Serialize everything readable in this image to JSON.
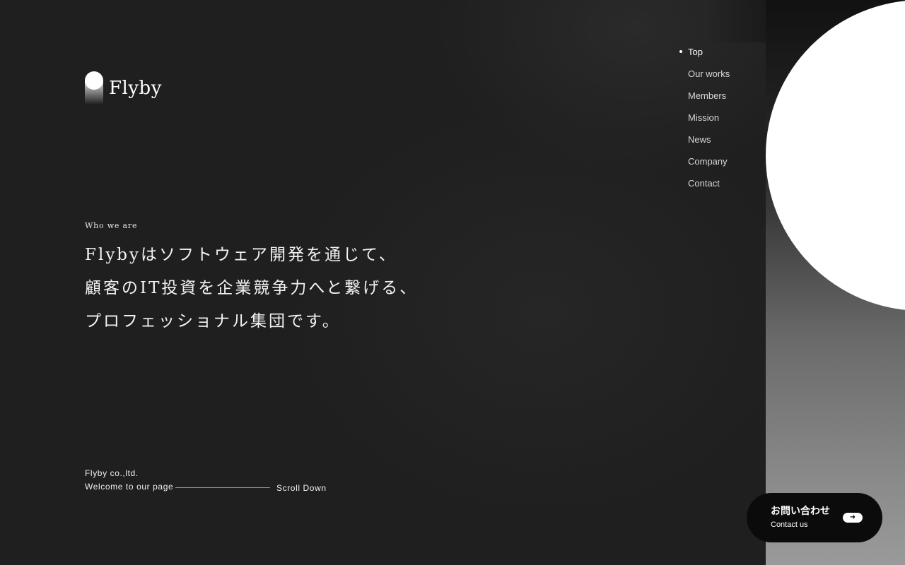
{
  "brand": {
    "name": "Flyby"
  },
  "nav": {
    "items": [
      {
        "label": "Top",
        "active": true
      },
      {
        "label": "Our works",
        "active": false
      },
      {
        "label": "Members",
        "active": false
      },
      {
        "label": "Mission",
        "active": false
      },
      {
        "label": "News",
        "active": false
      },
      {
        "label": "Company",
        "active": false
      },
      {
        "label": "Contact",
        "active": false
      }
    ]
  },
  "hero": {
    "eyebrow": "Who we are",
    "lines": [
      "Flybyはソフトウェア開発を通じて、",
      "顧客のIT投資を企業競争力へと繋げる、",
      "プロフェッショナル集団です。"
    ]
  },
  "footer": {
    "company": "Flyby co.,ltd.",
    "welcome": "Welcome to our page",
    "scroll_label": "Scroll Down"
  },
  "contact_button": {
    "label_jp": "お問い合わせ",
    "label_en": "Contact us",
    "icon": "arrow-right-icon"
  },
  "colors": {
    "background": "#1f1f1f",
    "text": "#ffffff",
    "button": "#0b0b0b"
  }
}
